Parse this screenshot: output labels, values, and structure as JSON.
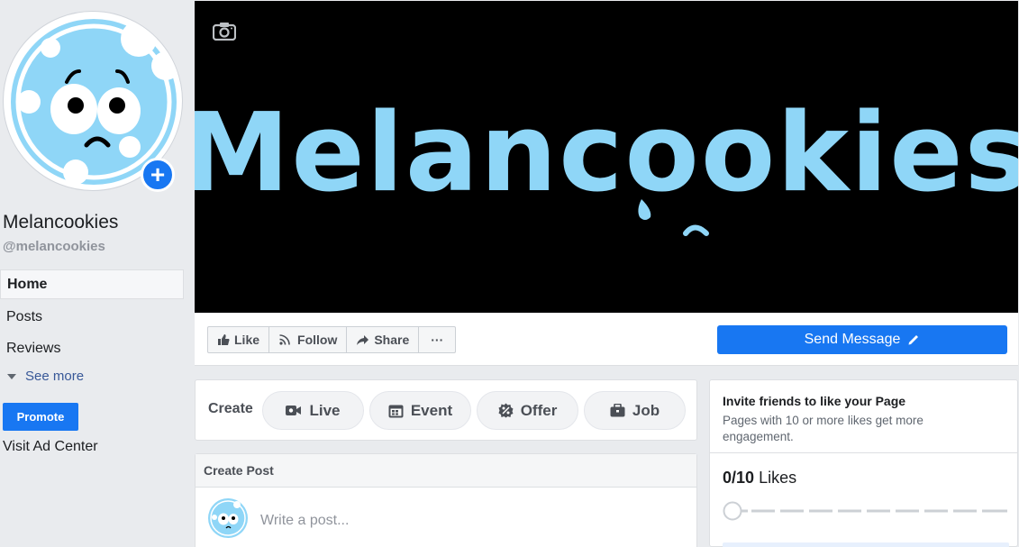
{
  "page": {
    "name": "Melancookies",
    "handle": "@melancookies",
    "cover_text": "Melancookies"
  },
  "sidebar": {
    "items": [
      {
        "label": "Home",
        "active": true
      },
      {
        "label": "Posts"
      },
      {
        "label": "Reviews"
      }
    ],
    "see_more": "See more",
    "promote": "Promote",
    "ad_center": "Visit Ad Center"
  },
  "actions": {
    "like": "Like",
    "follow": "Follow",
    "share": "Share",
    "more": "···",
    "send_message": "Send Message"
  },
  "create": {
    "label": "Create",
    "options": [
      "Live",
      "Event",
      "Offer",
      "Job"
    ]
  },
  "create_post": {
    "title": "Create Post",
    "placeholder": "Write a post..."
  },
  "invite": {
    "title": "Invite friends to like your Page",
    "description": "Pages with 10 or more likes get more engagement.",
    "likes_current": "0/10",
    "likes_label": "Likes",
    "progress": 0
  },
  "colors": {
    "brand_blue": "#1877f2",
    "cookie_blue": "#8fd6f7",
    "cover_bg": "#000000",
    "page_bg": "#e9ebee"
  },
  "icons": {
    "camera": "camera-icon",
    "plus": "plus-icon",
    "like": "thumbs-up-icon",
    "follow": "rss-icon",
    "share": "share-arrow-icon",
    "edit": "pencil-icon",
    "live": "video-camera-icon",
    "event": "calendar-icon",
    "offer": "percent-badge-icon",
    "job": "briefcase-icon"
  }
}
